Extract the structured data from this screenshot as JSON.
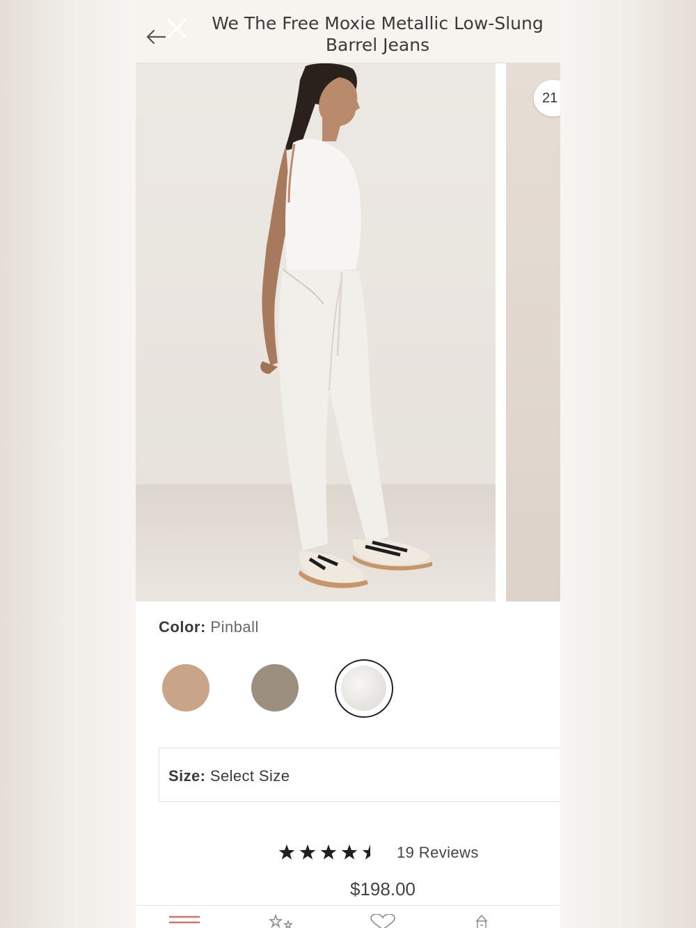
{
  "header": {
    "title": "We The Free Moxie Metallic Low-Slung Barrel Jeans"
  },
  "gallery": {
    "counter": "21"
  },
  "product": {
    "color_label": "Color:",
    "color_value": "Pinball",
    "swatches": [
      {
        "name": "tan",
        "color": "#c8a489",
        "selected": false
      },
      {
        "name": "taupe",
        "color": "#9d8f80",
        "selected": false
      },
      {
        "name": "pinball",
        "color": "#ebe9e6",
        "selected": true
      }
    ],
    "size_label": "Size:",
    "size_value": "Select Size",
    "rating": 4.5,
    "reviews_label": "19 Reviews",
    "price": "$198.00"
  },
  "tabbar": {
    "icons": [
      "menu-icon",
      "stars-icon",
      "heart-icon",
      "store-icon"
    ],
    "accent": "#d9716a"
  }
}
